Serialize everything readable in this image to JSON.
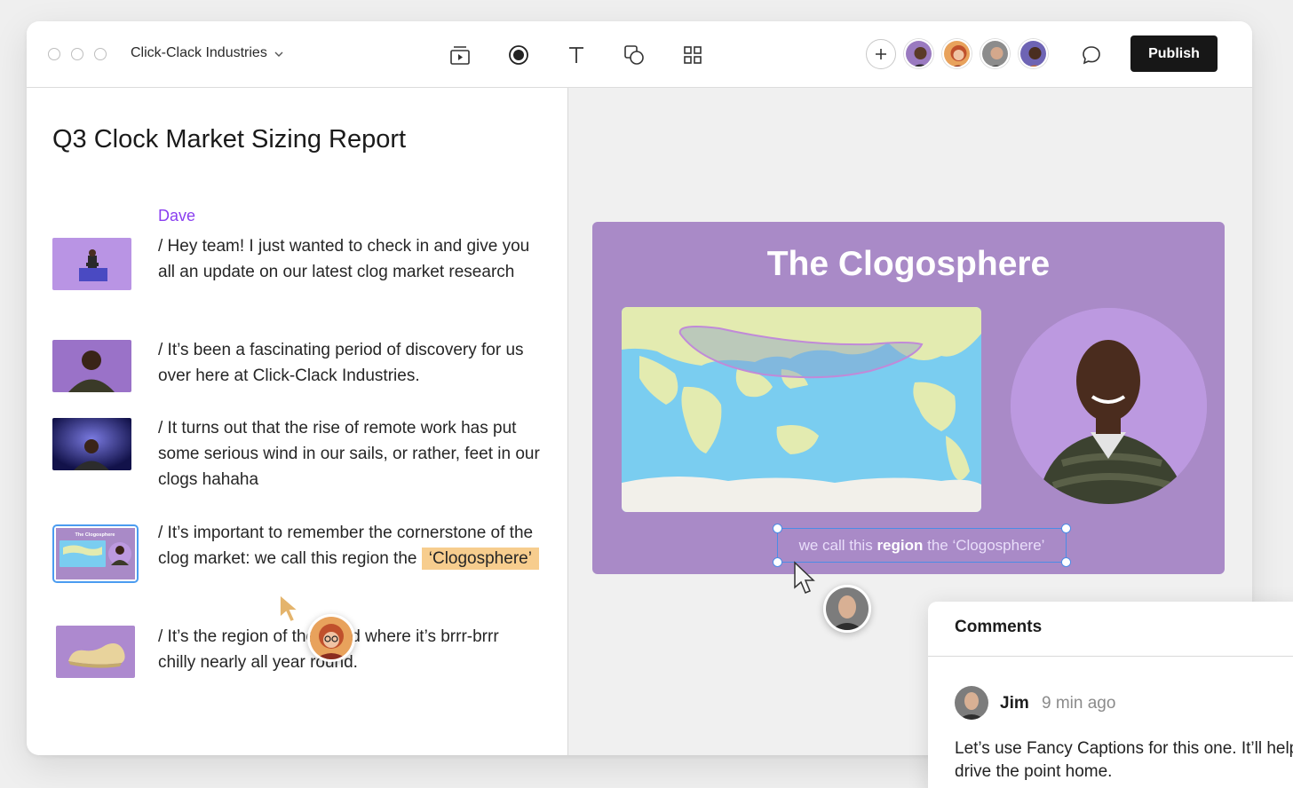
{
  "toolbar": {
    "workspace": "Click-Clack Industries",
    "publish_label": "Publish"
  },
  "document": {
    "title": "Q3 Clock Market Sizing Report",
    "speaker": "Dave",
    "lines": [
      "/ Hey team! I just wanted to check in and give you all an update on our latest clog market research",
      "/ It’s been a fascinating period of discovery for us over here at Click-Clack Industries.",
      "/ It turns out that the rise of remote work has put some serious wind in our sails, or rather, feet in our clogs hahaha",
      "/ It’s important to remember the cornerstone of the clog market: we call this region the",
      "/ It’s the region of the world where it’s brrr-brrr chilly nearly all year round."
    ],
    "highlight": "‘Clogosphere’",
    "slide_thumb_title": "The Clogosphere"
  },
  "slide": {
    "title": "The Clogosphere",
    "caption_pre": "we call this ",
    "caption_bold": "region",
    "caption_post": " the ‘Clogosphere’"
  },
  "comments": {
    "title": "Comments",
    "author": "Jim",
    "time": "9 min ago",
    "body": "Let’s use Fancy Captions for this one. It’ll help drive the point home."
  },
  "colors": {
    "accent_purple": "#8a3ff0",
    "slide_bg": "#a98ac7",
    "highlight": "#f7cd8e",
    "publish_bg": "#171717",
    "selection": "#4b8ce6"
  }
}
